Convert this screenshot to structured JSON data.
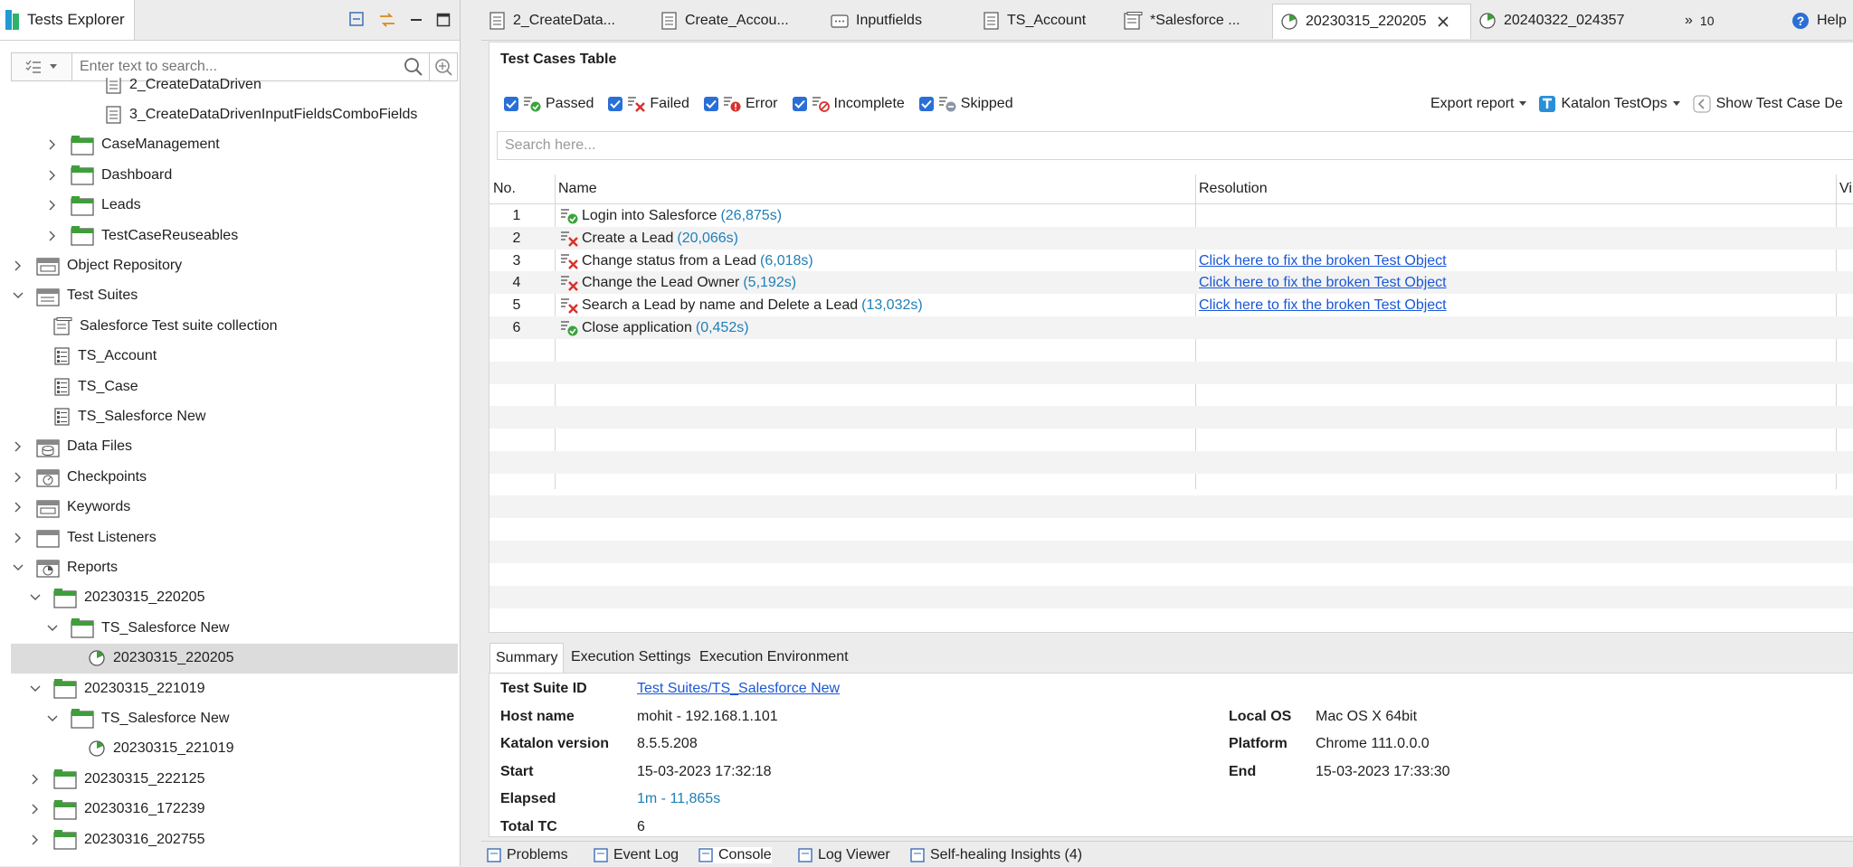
{
  "explorer": {
    "title": "Tests Explorer",
    "search_placeholder": "Enter text to search...",
    "tree": [
      {
        "label": "2_CreateDataDriven",
        "indent": 5,
        "type": "testcase",
        "expander": "none"
      },
      {
        "label": "3_CreateDataDrivenInputFieldsComboFields",
        "indent": 5,
        "type": "testcase",
        "expander": "none"
      },
      {
        "label": "CaseManagement",
        "indent": 3,
        "type": "folder",
        "expander": "collapsed"
      },
      {
        "label": "Dashboard",
        "indent": 3,
        "type": "folder",
        "expander": "collapsed"
      },
      {
        "label": "Leads",
        "indent": 3,
        "type": "folder",
        "expander": "collapsed"
      },
      {
        "label": "TestCaseReuseables",
        "indent": 3,
        "type": "folder",
        "expander": "collapsed"
      },
      {
        "label": "Object Repository",
        "indent": 1,
        "type": "object-repo",
        "expander": "collapsed"
      },
      {
        "label": "Test Suites",
        "indent": 1,
        "type": "suites",
        "expander": "expanded"
      },
      {
        "label": "Salesforce Test suite collection",
        "indent": 2,
        "type": "collection",
        "expander": "none"
      },
      {
        "label": "TS_Account",
        "indent": 2,
        "type": "suite",
        "expander": "none"
      },
      {
        "label": "TS_Case",
        "indent": 2,
        "type": "suite",
        "expander": "none"
      },
      {
        "label": "TS_Salesforce New",
        "indent": 2,
        "type": "suite",
        "expander": "none"
      },
      {
        "label": "Data Files",
        "indent": 1,
        "type": "data-files",
        "expander": "collapsed"
      },
      {
        "label": "Checkpoints",
        "indent": 1,
        "type": "checkpoints",
        "expander": "collapsed"
      },
      {
        "label": "Keywords",
        "indent": 1,
        "type": "keywords",
        "expander": "collapsed"
      },
      {
        "label": "Test Listeners",
        "indent": 1,
        "type": "listeners",
        "expander": "collapsed"
      },
      {
        "label": "Reports",
        "indent": 1,
        "type": "reports",
        "expander": "expanded"
      },
      {
        "label": "20230315_220205",
        "indent": 2,
        "type": "folder",
        "expander": "expanded"
      },
      {
        "label": "TS_Salesforce New",
        "indent": 3,
        "type": "folder",
        "expander": "expanded"
      },
      {
        "label": "20230315_220205",
        "indent": 4,
        "type": "report",
        "expander": "none",
        "selected": true
      },
      {
        "label": "20230315_221019",
        "indent": 2,
        "type": "folder",
        "expander": "expanded"
      },
      {
        "label": "TS_Salesforce New",
        "indent": 3,
        "type": "folder",
        "expander": "expanded"
      },
      {
        "label": "20230315_221019",
        "indent": 4,
        "type": "report",
        "expander": "none"
      },
      {
        "label": "20230315_222125",
        "indent": 2,
        "type": "folder",
        "expander": "collapsed"
      },
      {
        "label": "20230316_172239",
        "indent": 2,
        "type": "folder",
        "expander": "collapsed"
      },
      {
        "label": "20230316_202755",
        "indent": 2,
        "type": "folder",
        "expander": "collapsed"
      }
    ]
  },
  "editor_tabs": [
    {
      "label": "2_CreateData...",
      "icon": "testcase"
    },
    {
      "label": "Create_Accou...",
      "icon": "testcase"
    },
    {
      "label": "Inputfields",
      "icon": "object"
    },
    {
      "label": "TS_Account",
      "icon": "testcase"
    },
    {
      "label": "*Salesforce ...",
      "icon": "collection"
    },
    {
      "label": "20230315_220205",
      "icon": "report",
      "active": true,
      "closable": true
    },
    {
      "label": "20240322_024357",
      "icon": "report"
    }
  ],
  "overflow_tabs": "10",
  "help_label": "Help",
  "table": {
    "title": "Test Cases Table",
    "filters": [
      {
        "label": "Passed",
        "status": "passed"
      },
      {
        "label": "Failed",
        "status": "failed"
      },
      {
        "label": "Error",
        "status": "error"
      },
      {
        "label": "Incomplete",
        "status": "incomplete"
      },
      {
        "label": "Skipped",
        "status": "skipped"
      }
    ],
    "export_label": "Export report",
    "testops_label": "Katalon TestOps",
    "show_details_label": "Show Test Case De",
    "search_placeholder": "Search here...",
    "columns": [
      "No.",
      "Name",
      "Resolution",
      "Vi"
    ],
    "rows": [
      {
        "no": "1",
        "status": "passed",
        "name": "Login into Salesforce",
        "duration": "(26,875s)",
        "resolution": ""
      },
      {
        "no": "2",
        "status": "failed",
        "name": "Create a Lead",
        "duration": "(20,066s)",
        "resolution": ""
      },
      {
        "no": "3",
        "status": "failed",
        "name": "Change status from a Lead",
        "duration": "(6,018s)",
        "resolution": "Click here to fix the broken Test Object"
      },
      {
        "no": "4",
        "status": "failed",
        "name": "Change the Lead Owner",
        "duration": "(5,192s)",
        "resolution": "Click here to fix the broken Test Object"
      },
      {
        "no": "5",
        "status": "failed",
        "name": "Search a Lead by name and Delete a Lead",
        "duration": "(13,032s)",
        "resolution": "Click here to fix the broken Test Object"
      },
      {
        "no": "6",
        "status": "passed",
        "name": "Close application",
        "duration": "(0,452s)",
        "resolution": ""
      }
    ]
  },
  "summary_tabs": [
    "Summary",
    "Execution Settings",
    "Execution Environment"
  ],
  "summary": {
    "test_suite_id_label": "Test Suite ID",
    "test_suite_id": "Test Suites/TS_Salesforce New",
    "host_label": "Host name",
    "host": "mohit - 192.168.1.101",
    "katalon_label": "Katalon version",
    "katalon": "8.5.5.208",
    "start_label": "Start",
    "start": "15-03-2023 17:32:18",
    "elapsed_label": "Elapsed",
    "elapsed": "1m - 11,865s",
    "total_label": "Total TC",
    "total": "6",
    "os_label": "Local OS",
    "os": "Mac OS X 64bit",
    "platform_label": "Platform",
    "platform": "Chrome 111.0.0.0",
    "end_label": "End",
    "end": "15-03-2023 17:33:30"
  },
  "bottom_tabs": [
    "Problems",
    "Event Log",
    "Console",
    "Log Viewer",
    "Self-healing Insights (4)"
  ],
  "colors": {
    "accent": "#2a6fd6",
    "passed": "#3aa33a",
    "failed": "#d9302c",
    "link": "#1a57d6",
    "duration": "#1e7fb8",
    "folder": "#3f9e3a"
  }
}
